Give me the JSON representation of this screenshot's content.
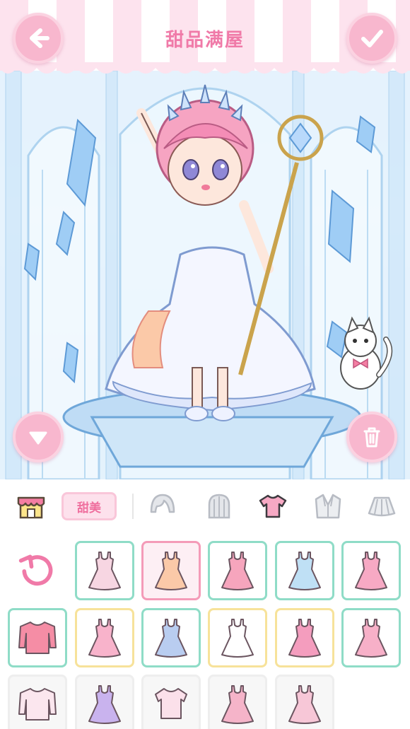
{
  "header": {
    "title": "甜品满屋"
  },
  "colors": {
    "accent_pink": "#f07aa8",
    "button_pink": "#f8b7ce",
    "border_green": "#8fdcc7",
    "border_pink": "#f49bb8",
    "border_yellow": "#f7e29a"
  },
  "buttons": {
    "back": "arrow-left-icon",
    "confirm": "check-icon",
    "collapse": "triangle-down-icon",
    "delete": "trash-icon"
  },
  "categories": {
    "style_tag": "甜美",
    "items": [
      {
        "name": "shop",
        "icon": "shop-icon",
        "selected": false
      },
      {
        "name": "hair-front",
        "icon": "hair-bangs-icon",
        "selected": false
      },
      {
        "name": "hair-back",
        "icon": "hair-back-icon",
        "selected": false
      },
      {
        "name": "top",
        "icon": "tshirt-icon",
        "selected": true
      },
      {
        "name": "coat",
        "icon": "coat-icon",
        "selected": false
      },
      {
        "name": "skirt",
        "icon": "skirt-icon",
        "selected": false
      }
    ]
  },
  "items": [
    {
      "kind": "dress",
      "color": "#f7d6e2",
      "border": "green",
      "selected": false
    },
    {
      "kind": "dress",
      "color": "#fbc9a8",
      "border": "pink",
      "selected": true
    },
    {
      "kind": "dress",
      "color": "#f6a5bd",
      "border": "green",
      "selected": false
    },
    {
      "kind": "dress",
      "color": "#bfe0f5",
      "border": "green",
      "selected": false
    },
    {
      "kind": "dress",
      "color": "#f7a9c4",
      "border": "green",
      "selected": false
    },
    {
      "kind": "sweater",
      "color": "#f58da5",
      "border": "green",
      "selected": false
    },
    {
      "kind": "dress",
      "color": "#f8b3cb",
      "border": "yellow",
      "selected": false
    },
    {
      "kind": "dress",
      "color": "#b9cdf0",
      "border": "green",
      "selected": false
    },
    {
      "kind": "dress",
      "color": "#ffffff",
      "border": "yellow",
      "selected": false
    },
    {
      "kind": "dress",
      "color": "#f49dbe",
      "border": "yellow",
      "selected": false
    },
    {
      "kind": "dress",
      "color": "#f7b0c8",
      "border": "green",
      "selected": false
    },
    {
      "kind": "sweater",
      "color": "#fbe6ee",
      "border": "none",
      "selected": false
    },
    {
      "kind": "dress",
      "color": "#c9b3ee",
      "border": "none",
      "selected": false
    },
    {
      "kind": "top",
      "color": "#fbe0ea",
      "border": "none",
      "selected": false
    },
    {
      "kind": "dress",
      "color": "#f5b4c9",
      "border": "none",
      "selected": false
    },
    {
      "kind": "dress",
      "color": "#f7c7d7",
      "border": "none",
      "selected": false
    }
  ]
}
